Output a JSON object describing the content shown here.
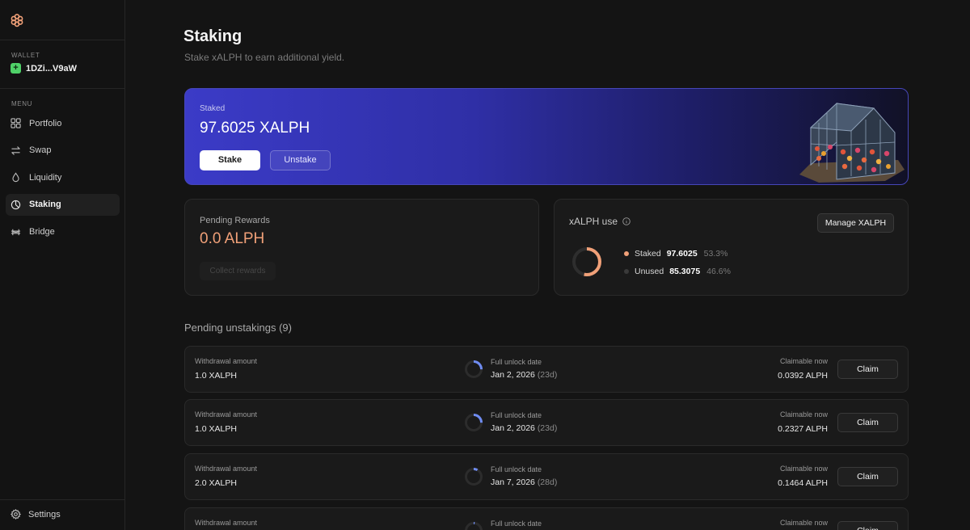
{
  "sidebar": {
    "wallet_label": "WALLET",
    "wallet_badge": "+",
    "wallet_address": "1DZi...V9aW",
    "menu_label": "MENU",
    "items": [
      {
        "label": "Portfolio",
        "icon": "grid-icon"
      },
      {
        "label": "Swap",
        "icon": "swap-arrows-icon"
      },
      {
        "label": "Liquidity",
        "icon": "droplet-icon"
      },
      {
        "label": "Staking",
        "icon": "pie-chart-icon",
        "active": true
      },
      {
        "label": "Bridge",
        "icon": "bridge-icon"
      }
    ],
    "settings_label": "Settings"
  },
  "header": {
    "title": "Staking",
    "subtitle": "Stake xALPH to earn additional yield."
  },
  "hero": {
    "label": "Staked",
    "value": "97.6025 XALPH",
    "stake_label": "Stake",
    "unstake_label": "Unstake"
  },
  "rewards": {
    "label": "Pending Rewards",
    "value": "0.0 ALPH",
    "collect_label": "Collect rewards"
  },
  "usage": {
    "title": "xALPH use",
    "manage_label": "Manage XALPH",
    "staked": {
      "name": "Staked",
      "value": "97.6025",
      "pct": "53.3%",
      "fraction": 0.533,
      "color": "#f0a078"
    },
    "unused": {
      "name": "Unused",
      "value": "85.3075",
      "pct": "46.6%",
      "fraction": 0.466,
      "color": "#3a3a3a"
    }
  },
  "pending": {
    "title": "Pending unstakings (9)",
    "withdrawal_label": "Withdrawal amount",
    "unlock_label": "Full unlock date",
    "claimable_label": "Claimable now",
    "claim_label": "Claim",
    "rows": [
      {
        "amount": "1.0 XALPH",
        "date": "Jan 2, 2026",
        "days": "(23d)",
        "claimable": "0.0392 ALPH",
        "progress": 0.25
      },
      {
        "amount": "1.0 XALPH",
        "date": "Jan 2, 2026",
        "days": "(23d)",
        "claimable": "0.2327 ALPH",
        "progress": 0.25
      },
      {
        "amount": "2.0 XALPH",
        "date": "Jan 7, 2026",
        "days": "(28d)",
        "claimable": "0.1464 ALPH",
        "progress": 0.08
      },
      {
        "amount": "",
        "date": "",
        "days": "",
        "claimable": "",
        "progress": 0.02
      }
    ]
  }
}
